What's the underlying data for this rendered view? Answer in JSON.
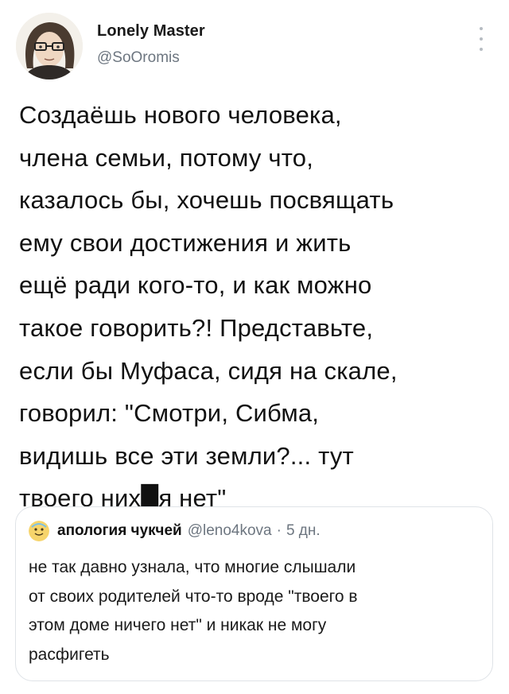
{
  "author": {
    "name": "Lonely Master",
    "handle": "@SoOromis",
    "avatar_icon": "portrait-with-glasses-avatar-icon"
  },
  "menu": {
    "icon": "more-vertical-icon"
  },
  "tweet": {
    "text": "Создаёшь нового человека,\nчлена семьи, потому что,\nказалось бы, хочешь посвящать\nему свои достижения и жить\nещё ради кого-то, и как можно\nтакое говорить?! Представьте,\nесли бы Муфаса, сидя на скале,\nговорил: \"Смотри, Сибма,\nвидишь все эти земли?... тут\nтвоего них█я нет\""
  },
  "quote": {
    "name": "апология чукчей",
    "handle": "@leno4kova",
    "separator": "·",
    "time": "5 дн.",
    "avatar_icon": "small-emoji-avatar-icon",
    "text": "не так давно узнала, что многие слышали\nот своих родителей что-то вроде \"твоего в\nэтом доме ничего нет\" и никак не могу\nрасфигеть"
  },
  "colors": {
    "background": "#ffffff",
    "text": "#111111",
    "secondary_text": "#6d7680",
    "card_border": "#dfe3e7"
  }
}
